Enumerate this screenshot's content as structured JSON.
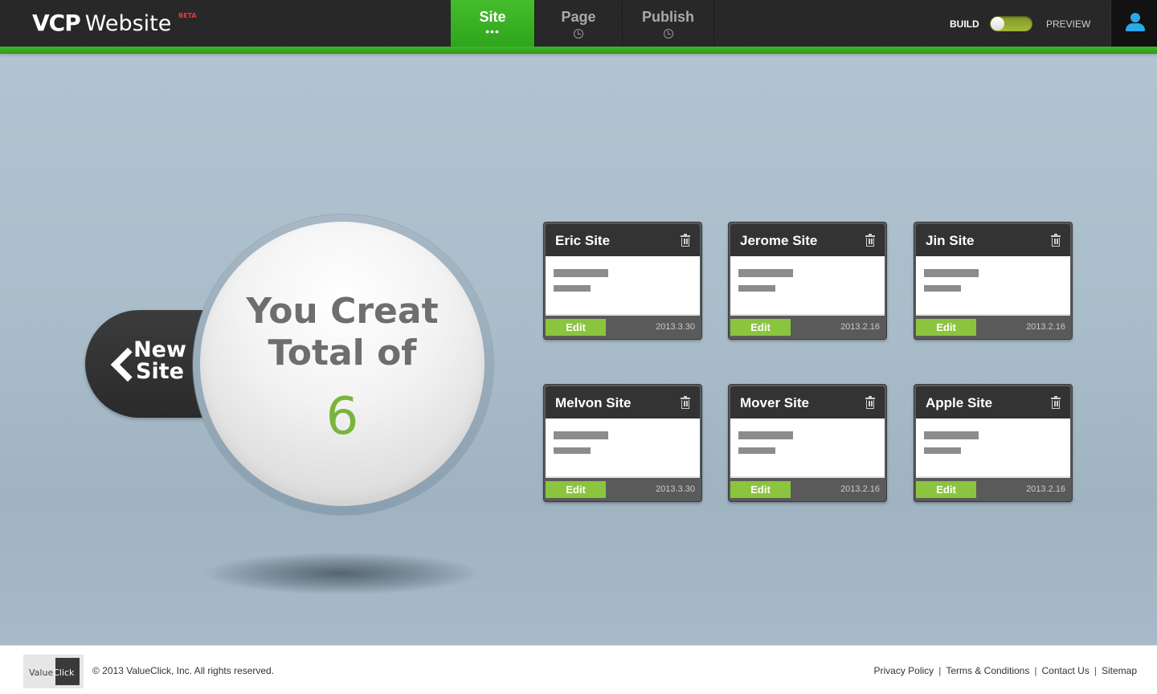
{
  "header": {
    "logo_primary": "VCP",
    "logo_secondary": "Website",
    "logo_badge": "BETA",
    "tabs": [
      {
        "label": "Site",
        "indicator": "•••"
      },
      {
        "label": "Page"
      },
      {
        "label": "Publish"
      }
    ],
    "mode_build": "BUILD",
    "mode_preview": "PREVIEW",
    "mode_toggle_state": "build",
    "accent_color": "#3fb52a",
    "user_icon": "user-icon"
  },
  "main": {
    "new_site_line1": "New",
    "new_site_line2": "Site",
    "headline_line1": "You Creat",
    "headline_line2": "Total of",
    "count": "6",
    "count_color": "#7ab43c"
  },
  "sites": [
    {
      "name": "Eric Site",
      "edit_label": "Edit",
      "date": "2013.3.30"
    },
    {
      "name": "Jerome Site",
      "edit_label": "Edit",
      "date": "2013.2.16"
    },
    {
      "name": "Jin Site",
      "edit_label": "Edit",
      "date": "2013.2.16"
    },
    {
      "name": "Melvon Site",
      "edit_label": "Edit",
      "date": "2013.3.30"
    },
    {
      "name": "Mover Site",
      "edit_label": "Edit",
      "date": "2013.2.16"
    },
    {
      "name": "Apple Site",
      "edit_label": "Edit",
      "date": "2013.2.16"
    }
  ],
  "footer": {
    "logo_text_a": "Value",
    "logo_text_b": "Click",
    "copyright": "© 2013 ValueClick, Inc. All rights reserved.",
    "links": [
      "Privacy Policy",
      "Terms & Conditions",
      "Contact Us",
      "Sitemap"
    ]
  }
}
